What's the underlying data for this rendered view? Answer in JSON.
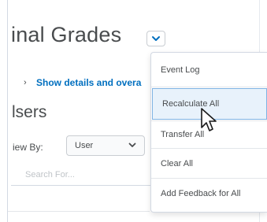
{
  "page": {
    "title": "inal Grades",
    "title_dropdown_icon": "chevron-down-icon"
  },
  "details": {
    "arrow": "›",
    "link_text": "Show details and overa"
  },
  "users_section": {
    "title": "lsers",
    "view_by_label": "iew By:",
    "view_by_value": "User",
    "search_placeholder": "Search For..."
  },
  "menu": {
    "items": [
      {
        "label": "Event Log"
      },
      {
        "label": "Recalculate All",
        "highlighted": true
      },
      {
        "label": "Transfer All"
      },
      {
        "label": "Clear All"
      },
      {
        "label": "Add Feedback for All"
      }
    ]
  },
  "colors": {
    "link": "#006fbf",
    "highlight_bg": "#e8f2fb",
    "highlight_border": "#7fb3e3",
    "text": "#494c4e"
  },
  "cursor": {
    "icon": "mouse-pointer-icon"
  }
}
